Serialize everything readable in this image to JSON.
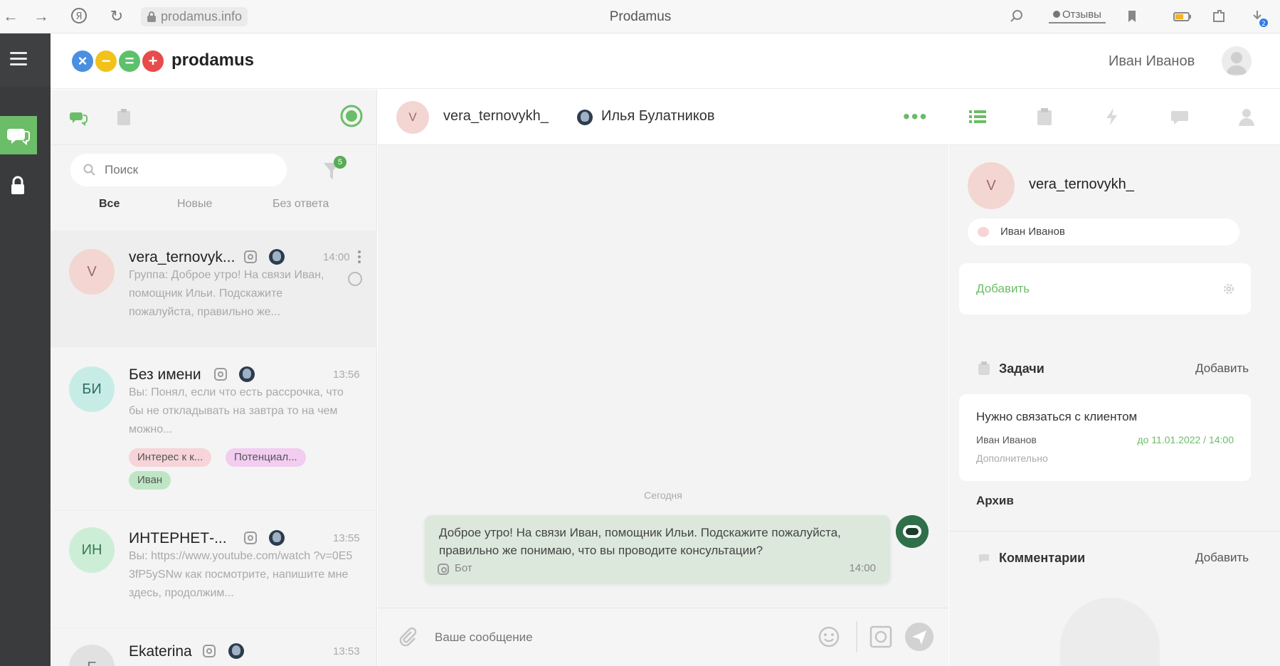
{
  "browser": {
    "url": "prodamus.info",
    "title": "Prodamus",
    "reviews_label": "Отзывы"
  },
  "app": {
    "logo_text": "prodamus",
    "user_name": "Иван Иванов"
  },
  "list": {
    "search_placeholder": "Поиск",
    "filter_badge": "5",
    "tabs": [
      "Все",
      "Новые",
      "Без ответа"
    ],
    "conversations": [
      {
        "initials": "V",
        "name": "vera_ternovyk...",
        "time": "14:00",
        "preview": "Группа: Доброе утро! На связи Иван, помощник Ильи. Подскажите пожалуйста, правильно же..."
      },
      {
        "initials": "БИ",
        "name": "Без имени",
        "time": "13:56",
        "preview": "Вы: Понял, если что есть рассрочка, что бы не откладывать на завтра то на чем можно...",
        "tags": [
          "Интерес к к...",
          "Потенциал...",
          "Иван"
        ]
      },
      {
        "initials": "ИН",
        "name": "ИНТЕРНЕТ-...",
        "time": "13:55",
        "preview": "Вы: https://www.youtube.com/watch ?v=0E53fP5ySNw как посмотрите, напишите мне здесь, продолжим..."
      },
      {
        "initials": "E",
        "name": "Ekaterina",
        "time": "13:53"
      }
    ]
  },
  "chat": {
    "initials": "V",
    "name": "vera_ternovykh_",
    "operator": "Илья Булатников",
    "more": "•••",
    "date_divider": "Сегодня",
    "message": {
      "text": "Доброе утро! На связи Иван, помощник Ильи. Подскажите пожалуйста, правильно же понимаю, что вы проводите консультации?",
      "source": "Бот",
      "time": "14:00"
    },
    "composer_placeholder": "Ваше сообщение"
  },
  "info": {
    "initials": "V",
    "name": "vera_ternovykh_",
    "responsible": "Иван Иванов",
    "add_label": "Добавить",
    "tasks_title": "Задачи",
    "tasks_add": "Добавить",
    "task": {
      "title": "Нужно связаться с клиентом",
      "assignee": "Иван Иванов",
      "due": "до 11.01.2022 / 14:00",
      "extra": "Дополнительно"
    },
    "archive_label": "Архив",
    "comments_title": "Комментарии",
    "comments_add": "Добавить"
  },
  "colors": {
    "accent_green": "#6cbd67",
    "rail": "#3a3b3d",
    "avatar_pink": "#f3d6d1",
    "avatar_teal": "#c7ece6",
    "avatar_green": "#cdeed6",
    "tag_pink": "#f6d4d8",
    "tag_purple": "#f2cdf0",
    "tag_green": "#bfe6c4",
    "bubble": "#dde8dc"
  },
  "icons": {
    "back": "back-arrow-icon",
    "forward": "forward-arrow-icon",
    "yandex": "yandex-icon",
    "reload": "reload-icon",
    "lock": "lock-icon",
    "menu": "hamburger-icon",
    "chats": "chats-icon",
    "clipboard": "clipboard-icon",
    "status": "online-status-icon",
    "search": "search-icon",
    "filter": "filter-icon",
    "attach": "paperclip-icon",
    "emoji": "smiley-icon",
    "image": "image-icon",
    "send": "send-icon"
  }
}
